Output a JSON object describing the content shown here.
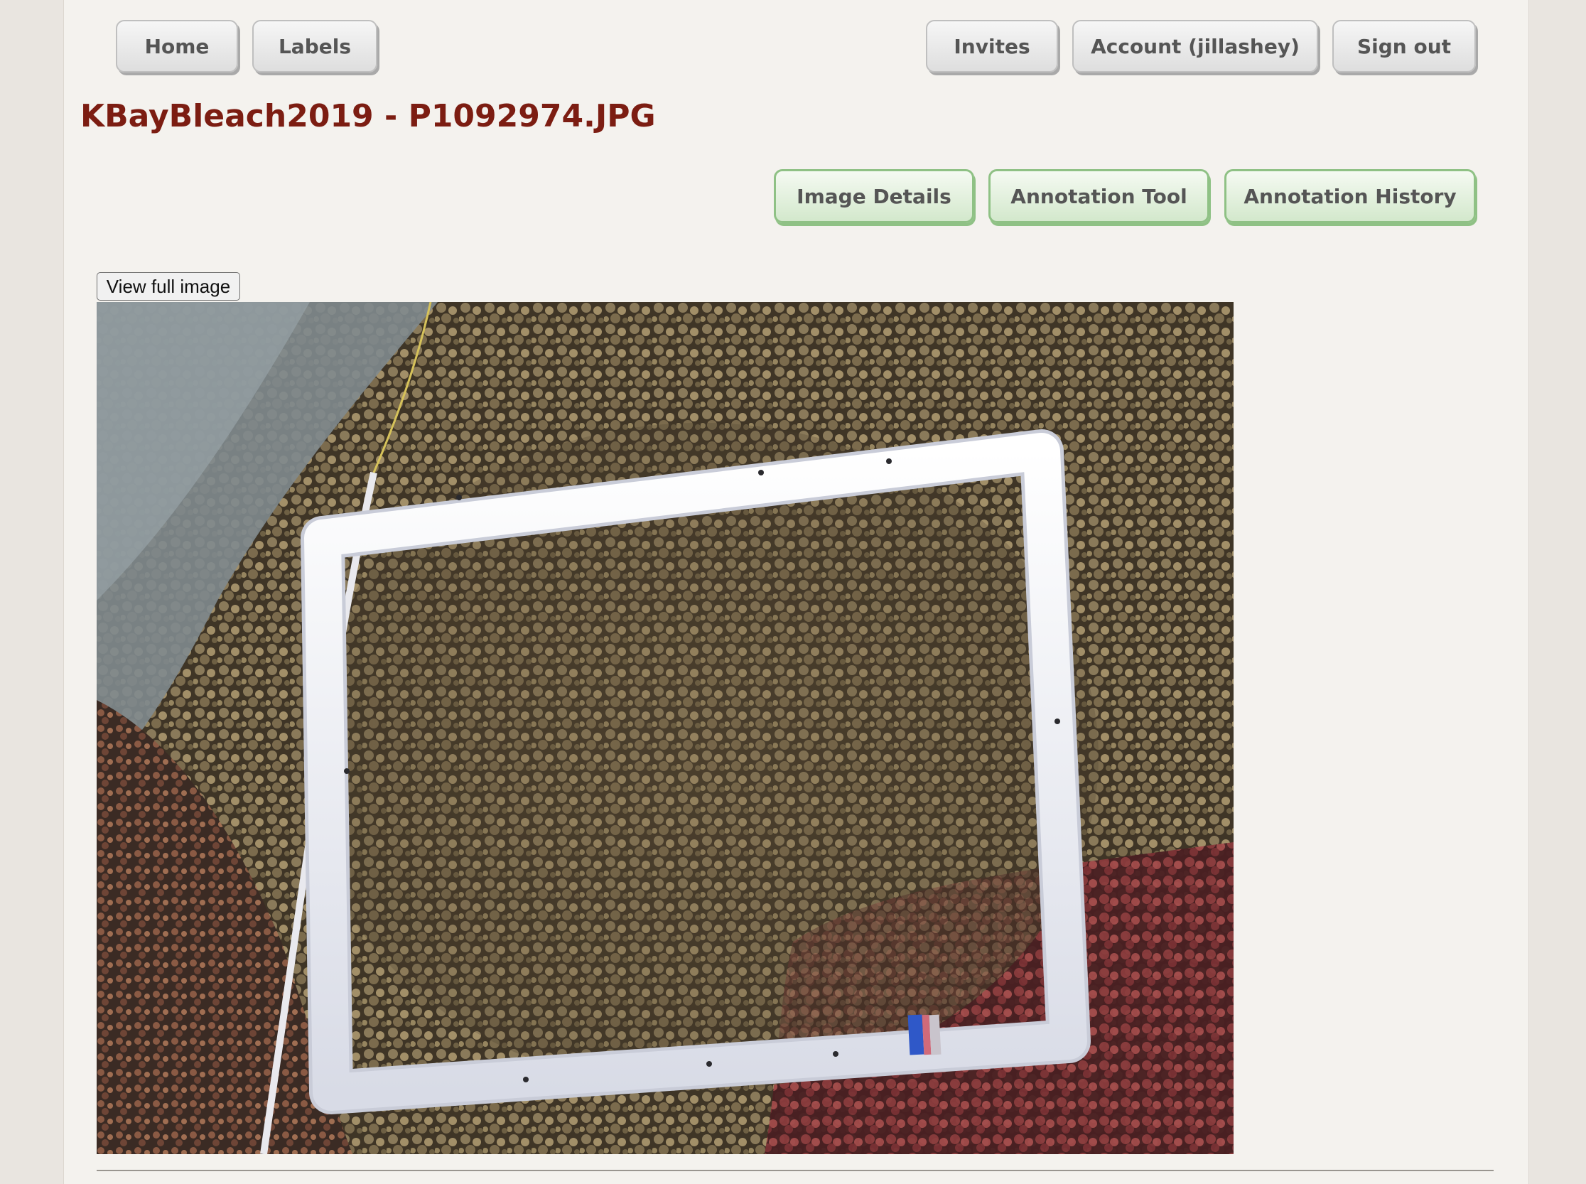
{
  "nav": {
    "home": "Home",
    "labels": "Labels",
    "invites": "Invites",
    "account": "Account (jillashey)",
    "signout": "Sign out"
  },
  "title": "KBayBleach2019 - P1092974.JPG",
  "image_tabs": {
    "details": "Image Details",
    "annotation_tool": "Annotation Tool",
    "annotation_history": "Annotation History"
  },
  "view_full_image": "View full image",
  "colors": {
    "title": "#7c1d12",
    "green_button_border": "#8fc185",
    "page_background": "#f4f2ee"
  }
}
